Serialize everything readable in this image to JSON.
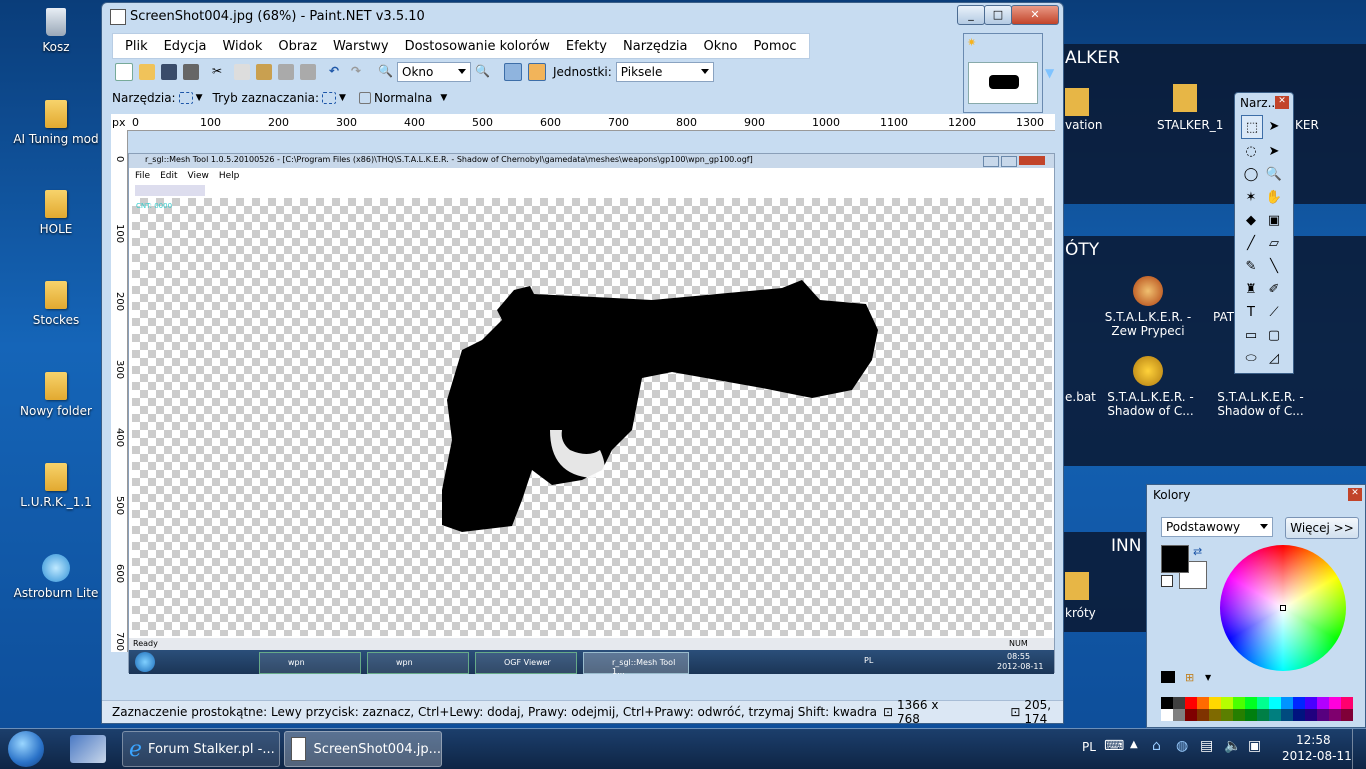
{
  "desktop": {
    "icons": [
      {
        "label": "Kosz",
        "icon": "recycle-bin-icon"
      },
      {
        "label": "AI Tuning mod",
        "icon": "folder-icon"
      },
      {
        "label": "HOLE",
        "icon": "folder-icon"
      },
      {
        "label": "Stockes",
        "icon": "folder-icon"
      },
      {
        "label": "Nowy folder",
        "icon": "folder-icon"
      },
      {
        "label": "L.U.R.K._1.1",
        "icon": "folder-icon"
      },
      {
        "label": "Astroburn Lite",
        "icon": "astroburn-icon"
      }
    ],
    "right_panels": {
      "stalker_header": "ALKER",
      "stalker_items": [
        "vation",
        "STALKER_1",
        "KER"
      ],
      "skroty_header": "ÓTY",
      "skroty_items": [
        "S.T.A.L.K.E.R. - Zew Prypeci",
        "PAT",
        "e.bat",
        "S.T.A.L.K.E.R. - Shadow of C...",
        "S.T.A.L.K.E.R. - Shadow of C..."
      ],
      "inn_header": "INN",
      "inn_items": [
        "króty"
      ]
    }
  },
  "main_window": {
    "title": "ScreenShot004.jpg (68%) - Paint.NET v3.5.10",
    "menu": [
      "Plik",
      "Edycja",
      "Widok",
      "Obraz",
      "Warstwy",
      "Dostosowanie kolorów",
      "Efekty",
      "Narzędzia",
      "Okno",
      "Pomoc"
    ],
    "toolbar": {
      "zoom_value": "Okno",
      "units_label": "Jednostki:",
      "units_value": "Piksele"
    },
    "toolbar2": {
      "tools_label": "Narzędzia:",
      "selection_mode_label": "Tryb zaznaczania:",
      "blend_value": "Normalna"
    },
    "ruler_label": "px",
    "ruler_top": [
      "0",
      "100",
      "200",
      "300",
      "400",
      "500",
      "600",
      "700",
      "800",
      "900",
      "1000",
      "1100",
      "1200",
      "1300"
    ],
    "ruler_left": [
      "0",
      "100",
      "200",
      "300",
      "400",
      "500",
      "600",
      "700"
    ],
    "status": {
      "hint": "Zaznaczenie prostokątne: Lewy przycisk: zaznacz, Ctrl+Lewy: dodaj, Prawy: odejmij, Ctrl+Prawy: odwróć, trzymaj Shift: kwadra",
      "size": "1366 x 768",
      "coords": "205, 174"
    }
  },
  "inner_screenshot": {
    "title": "r_sgl::Mesh Tool 1.0.5.20100526 - [C:\\Program Files (x86)\\THQ\\S.T.A.L.K.E.R. - Shadow of Chernobyl\\gamedata\\meshes\\weapons\\gp100\\wpn_gp100.ogf]",
    "menu": [
      "File",
      "Edit",
      "View",
      "Help"
    ],
    "cnt_label": "CNT: 0000",
    "status": "Ready",
    "num": "NUM",
    "taskbar_items": [
      "wpn",
      "wpn",
      "OGF Viewer",
      "r_sgl::Mesh Tool 1..."
    ],
    "tray_lang": "PL",
    "tray_time": "08:55",
    "tray_date": "2012-08-11"
  },
  "tools_window": {
    "title": "Narz..."
  },
  "colors_window": {
    "title": "Kolory",
    "palette_value": "Podstawowy",
    "more_button": "Więcej >>",
    "primary_color": "#000000",
    "secondary_color": "#ffffff",
    "palette_colors": [
      "#000000",
      "#404040",
      "#ff0000",
      "#ff6a00",
      "#ffd800",
      "#b6ff00",
      "#4cff00",
      "#00ff21",
      "#00ff90",
      "#00ffff",
      "#0094ff",
      "#0026ff",
      "#4800ff",
      "#b200ff",
      "#ff00dc",
      "#ff006e"
    ],
    "palette_dark": [
      "#ffffff",
      "#808080",
      "#7f0000",
      "#7f3300",
      "#7f6a00",
      "#5b7f00",
      "#267f00",
      "#007f0e",
      "#007f46",
      "#007f7f",
      "#004a7f",
      "#00137f",
      "#21007f",
      "#57007f",
      "#7f006e",
      "#7f0037"
    ]
  },
  "taskbar": {
    "items": [
      "Forum Stalker.pl -...",
      "ScreenShot004.jp..."
    ],
    "lang": "PL",
    "time": "12:58",
    "date": "2012-08-11"
  }
}
